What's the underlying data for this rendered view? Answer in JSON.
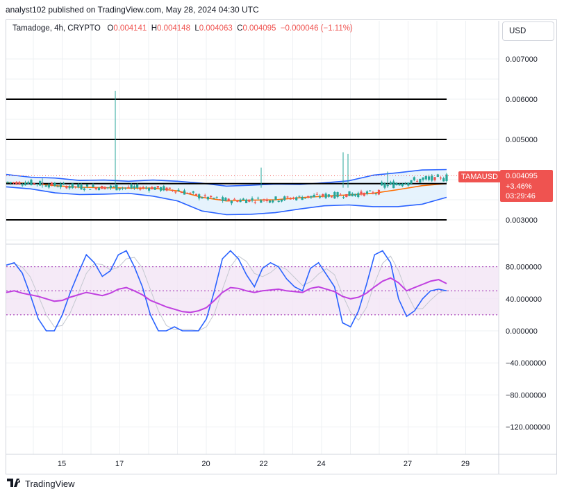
{
  "header": {
    "published": "analyst102 published on TradingView.com, May 28, 2024 04:30 UTC"
  },
  "legend": {
    "symbol": "Tamadoge, 4h, CRYPTO",
    "o_label": "O",
    "o": "0.004141",
    "h_label": "H",
    "h": "0.004148",
    "l_label": "L",
    "l": "0.004063",
    "c_label": "C",
    "c": "0.004095",
    "change": "−0.000046 (−1.11%)"
  },
  "currency_button": "USD",
  "price_tag": {
    "symbol": "TAMAUSD",
    "price": "0.004095",
    "change": "+3.46%",
    "countdown": "03:29:46"
  },
  "brand": {
    "name": "TradingView",
    "logo_icon": "tradingview-logo-icon"
  },
  "colors": {
    "up": "#26a69a",
    "down": "#ef5350",
    "bb": "#2962ff",
    "basis": "#ff6d00",
    "bb_fill": "#e3f2fd",
    "stoch_k": "#2962ff",
    "rsi": "#c040e0",
    "band_fill": "#f3e5f5"
  },
  "chart_data": [
    {
      "type": "candlestick",
      "title": "Tamadoge, 4h, CRYPTO",
      "currency": "USD",
      "ylim": [
        0.00235,
        0.0075
      ],
      "y_ticks": [
        "0.007000",
        "0.006000",
        "0.005000",
        "0.003000"
      ],
      "x_ticks": [
        "15",
        "17",
        "20",
        "22",
        "24",
        "27",
        "29"
      ],
      "horizontal_levels": [
        0.006,
        0.005,
        0.0039,
        0.003
      ],
      "last_price": 0.004095,
      "candles_sample": [
        {
          "x": "13",
          "o": 0.00395,
          "h": 0.00403,
          "l": 0.00391,
          "c": 0.00399
        },
        {
          "x": "15",
          "o": 0.0037,
          "h": 0.0038,
          "l": 0.00362,
          "c": 0.00365
        },
        {
          "x": "17",
          "o": 0.00376,
          "h": 0.00621,
          "l": 0.00372,
          "c": 0.00378
        },
        {
          "x": "20",
          "o": 0.00322,
          "h": 0.0033,
          "l": 0.00318,
          "c": 0.00325
        },
        {
          "x": "22",
          "o": 0.00351,
          "h": 0.0043,
          "l": 0.00346,
          "c": 0.00356
        },
        {
          "x": "24",
          "o": 0.00358,
          "h": 0.00468,
          "l": 0.00352,
          "c": 0.00362
        },
        {
          "x": "27",
          "o": 0.00382,
          "h": 0.0042,
          "l": 0.00376,
          "c": 0.00392
        },
        {
          "x": "28",
          "o": 0.004141,
          "h": 0.004148,
          "l": 0.004063,
          "c": 0.004095
        }
      ],
      "bollinger": {
        "upper": [
          0.00413,
          0.00406,
          0.00404,
          0.00398,
          0.00399,
          0.00396,
          0.00399,
          0.00396,
          0.00391,
          0.00384,
          0.00386,
          0.00389,
          0.00388,
          0.00392,
          0.00397,
          0.00411,
          0.00417,
          0.00424,
          0.00425
        ],
        "basis": [
          0.00392,
          0.00391,
          0.00385,
          0.00381,
          0.0038,
          0.00379,
          0.00379,
          0.00372,
          0.00356,
          0.00347,
          0.00349,
          0.0035,
          0.00355,
          0.00359,
          0.00362,
          0.00366,
          0.00375,
          0.00385,
          0.0039
        ],
        "lower": [
          0.00382,
          0.00377,
          0.00367,
          0.00363,
          0.00364,
          0.00366,
          0.00359,
          0.00347,
          0.00322,
          0.00313,
          0.00314,
          0.00318,
          0.00327,
          0.00335,
          0.00337,
          0.00333,
          0.00333,
          0.00339,
          0.00356
        ]
      }
    },
    {
      "type": "line",
      "title": "Stochastic RSI",
      "ylim": [
        -140,
        100
      ],
      "y_ticks": [
        "80.000000",
        "40.000000",
        "0.000000",
        "−40.000000",
        "−80.000000",
        "−120.000000"
      ],
      "band": [
        20,
        80
      ],
      "series": [
        {
          "values": [
            82,
            85,
            72,
            45,
            15,
            0,
            0,
            20,
            48,
            72,
            95,
            85,
            68,
            75,
            95,
            100,
            80,
            55,
            20,
            0,
            0,
            5,
            0,
            0,
            0,
            15,
            50,
            90,
            100,
            90,
            70,
            55,
            78,
            85,
            80,
            65,
            55,
            50,
            78,
            85,
            70,
            55,
            10,
            5,
            25,
            58,
            95,
            100,
            85,
            40,
            18,
            25,
            40,
            50,
            52,
            50
          ]
        },
        {
          "values": [
            48,
            50,
            47,
            45,
            43,
            40,
            37,
            38,
            42,
            45,
            48,
            46,
            44,
            47,
            52,
            54,
            50,
            45,
            38,
            34,
            30,
            27,
            24,
            23,
            25,
            29,
            38,
            48,
            54,
            53,
            50,
            48,
            50,
            51,
            52,
            50,
            49,
            48,
            53,
            55,
            52,
            49,
            43,
            40,
            42,
            47,
            55,
            62,
            66,
            60,
            50,
            54,
            58,
            62,
            64,
            59
          ]
        }
      ]
    }
  ]
}
